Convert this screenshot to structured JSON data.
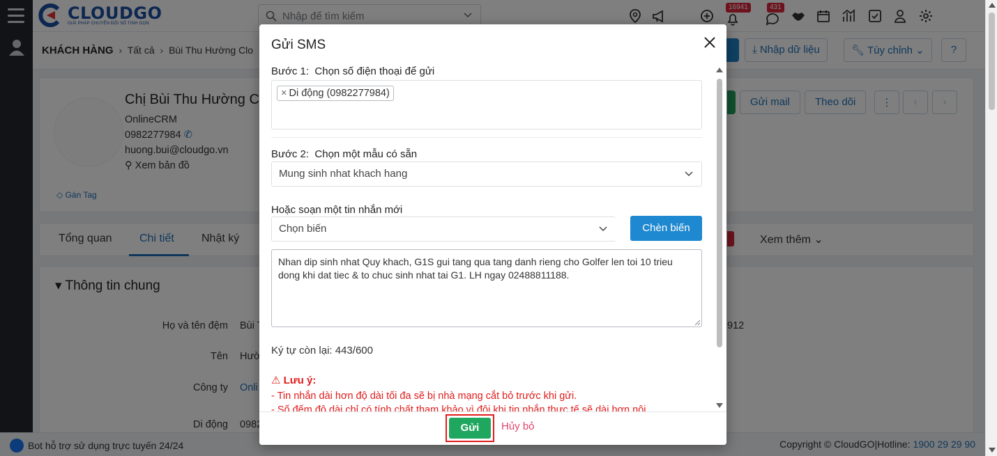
{
  "app": {
    "logo_text": "CLOUDGO",
    "logo_sub": "GIẢI PHÁP CHUYỂN ĐỔI SỐ TINH GỌN",
    "search_placeholder": "Nhập để tìm kiếm",
    "badge_notifications": "16941",
    "badge_messages": "431"
  },
  "breadcrumb": {
    "module": "KHÁCH HÀNG",
    "all": "Tất cả",
    "current": "Bùi Thu Hường Clo"
  },
  "header_buttons": {
    "import": "Nhập dữ liệu",
    "customize": "Tùy chỉnh"
  },
  "profile": {
    "name": "Chị Bùi Thu Hường C",
    "company": "OnlineCRM",
    "phone": "0982277984",
    "email": "huong.bui@cloudgo.vn",
    "map": "Xem bản đồ",
    "tag": "Gán Tag",
    "send_mail": "Gửi mail",
    "follow": "Theo dõi"
  },
  "tabs": {
    "overview": "Tổng quan",
    "detail": "Chi tiết",
    "log": "Nhật ký",
    "more": "Xem thêm"
  },
  "general": {
    "title": "Thông tin chung",
    "rows": [
      {
        "label": "Họ và tên đệm",
        "value": "Bùi T"
      },
      {
        "label": "Tên",
        "value": "Hườ"
      },
      {
        "label": "Công ty",
        "value": "Onli"
      },
      {
        "label": "Di động",
        "value": "0982"
      }
    ],
    "right_value": "912"
  },
  "footer": {
    "bot": "Bot hỗ trợ sử dụng trực tuyến 24/24",
    "copyright": "Copyright © CloudGO|Hotline: ",
    "hotline": "1900 29 29 90"
  },
  "modal": {
    "title": "Gửi SMS",
    "step1_label": "Bước 1:",
    "step1_text": "Chọn số điện thoại để gửi",
    "phone_chip": "Di động (0982277984)",
    "step2_label": "Bước 2:",
    "step2_text": "Chọn một mẫu có sẵn",
    "template_selected": "Mung sinh nhat khach hang",
    "compose_label": "Hoặc soạn một tin nhắn mới",
    "variable_placeholder": "Chọn biến",
    "insert_variable": "Chèn biến",
    "message": "Nhan dip sinh nhat Quy khach, G1S gui tang qua tang danh rieng cho Golfer len toi 10 trieu dong khi dat tiec & to chuc sinh nhat tai G1. LH ngay 02488811188.",
    "remaining": "Ký tự còn lại: 443/600",
    "note_title": "Lưu ý:",
    "note_1": "- Tin nhắn dài hơn độ dài tối đa sẽ bị nhà mạng cắt bỏ trước khi gửi.",
    "note_2": "- Số đếm độ dài chỉ có tính chất tham khảo vì đôi khi tin nhắn thực tế sẽ dài hơn nội",
    "send": "Gửi",
    "cancel": "Hủy bỏ"
  }
}
